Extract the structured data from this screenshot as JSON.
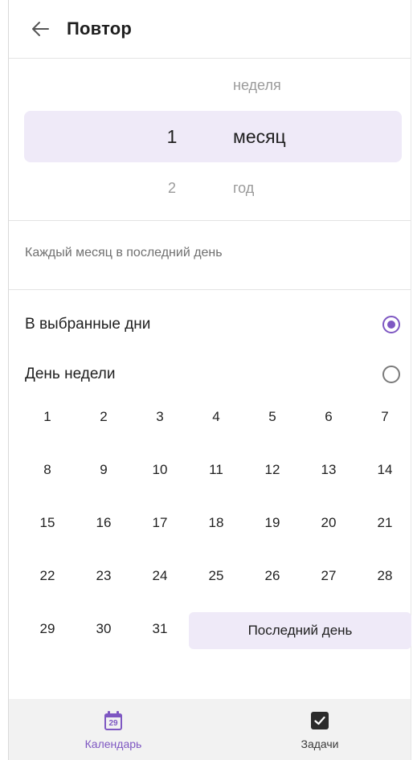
{
  "header": {
    "title": "Повтор",
    "back_icon": "arrow-left-icon"
  },
  "picker": {
    "rows": [
      {
        "num": "",
        "unit": "неделя"
      },
      {
        "num": "1",
        "unit": "месяц"
      },
      {
        "num": "2",
        "unit": "год"
      }
    ],
    "selected_index": 1
  },
  "summary": "Каждый месяц в последний день",
  "options": [
    {
      "label": "В выбранные дни",
      "selected": true
    },
    {
      "label": "День недели",
      "selected": false
    }
  ],
  "days": [
    "1",
    "2",
    "3",
    "4",
    "5",
    "6",
    "7",
    "8",
    "9",
    "10",
    "11",
    "12",
    "13",
    "14",
    "15",
    "16",
    "17",
    "18",
    "19",
    "20",
    "21",
    "22",
    "23",
    "24",
    "25",
    "26",
    "27",
    "28",
    "29",
    "30",
    "31"
  ],
  "last_day_label": "Последний день",
  "bottom_nav": {
    "calendar": {
      "label": "Календарь",
      "icon": "calendar-icon",
      "icon_text": "29",
      "active": true
    },
    "tasks": {
      "label": "Задачи",
      "icon": "checkbox-icon",
      "active": false
    }
  },
  "colors": {
    "accent": "#7e57c2",
    "selected_bg": "#efeaf8",
    "nav_bg": "#f2f2f2"
  }
}
